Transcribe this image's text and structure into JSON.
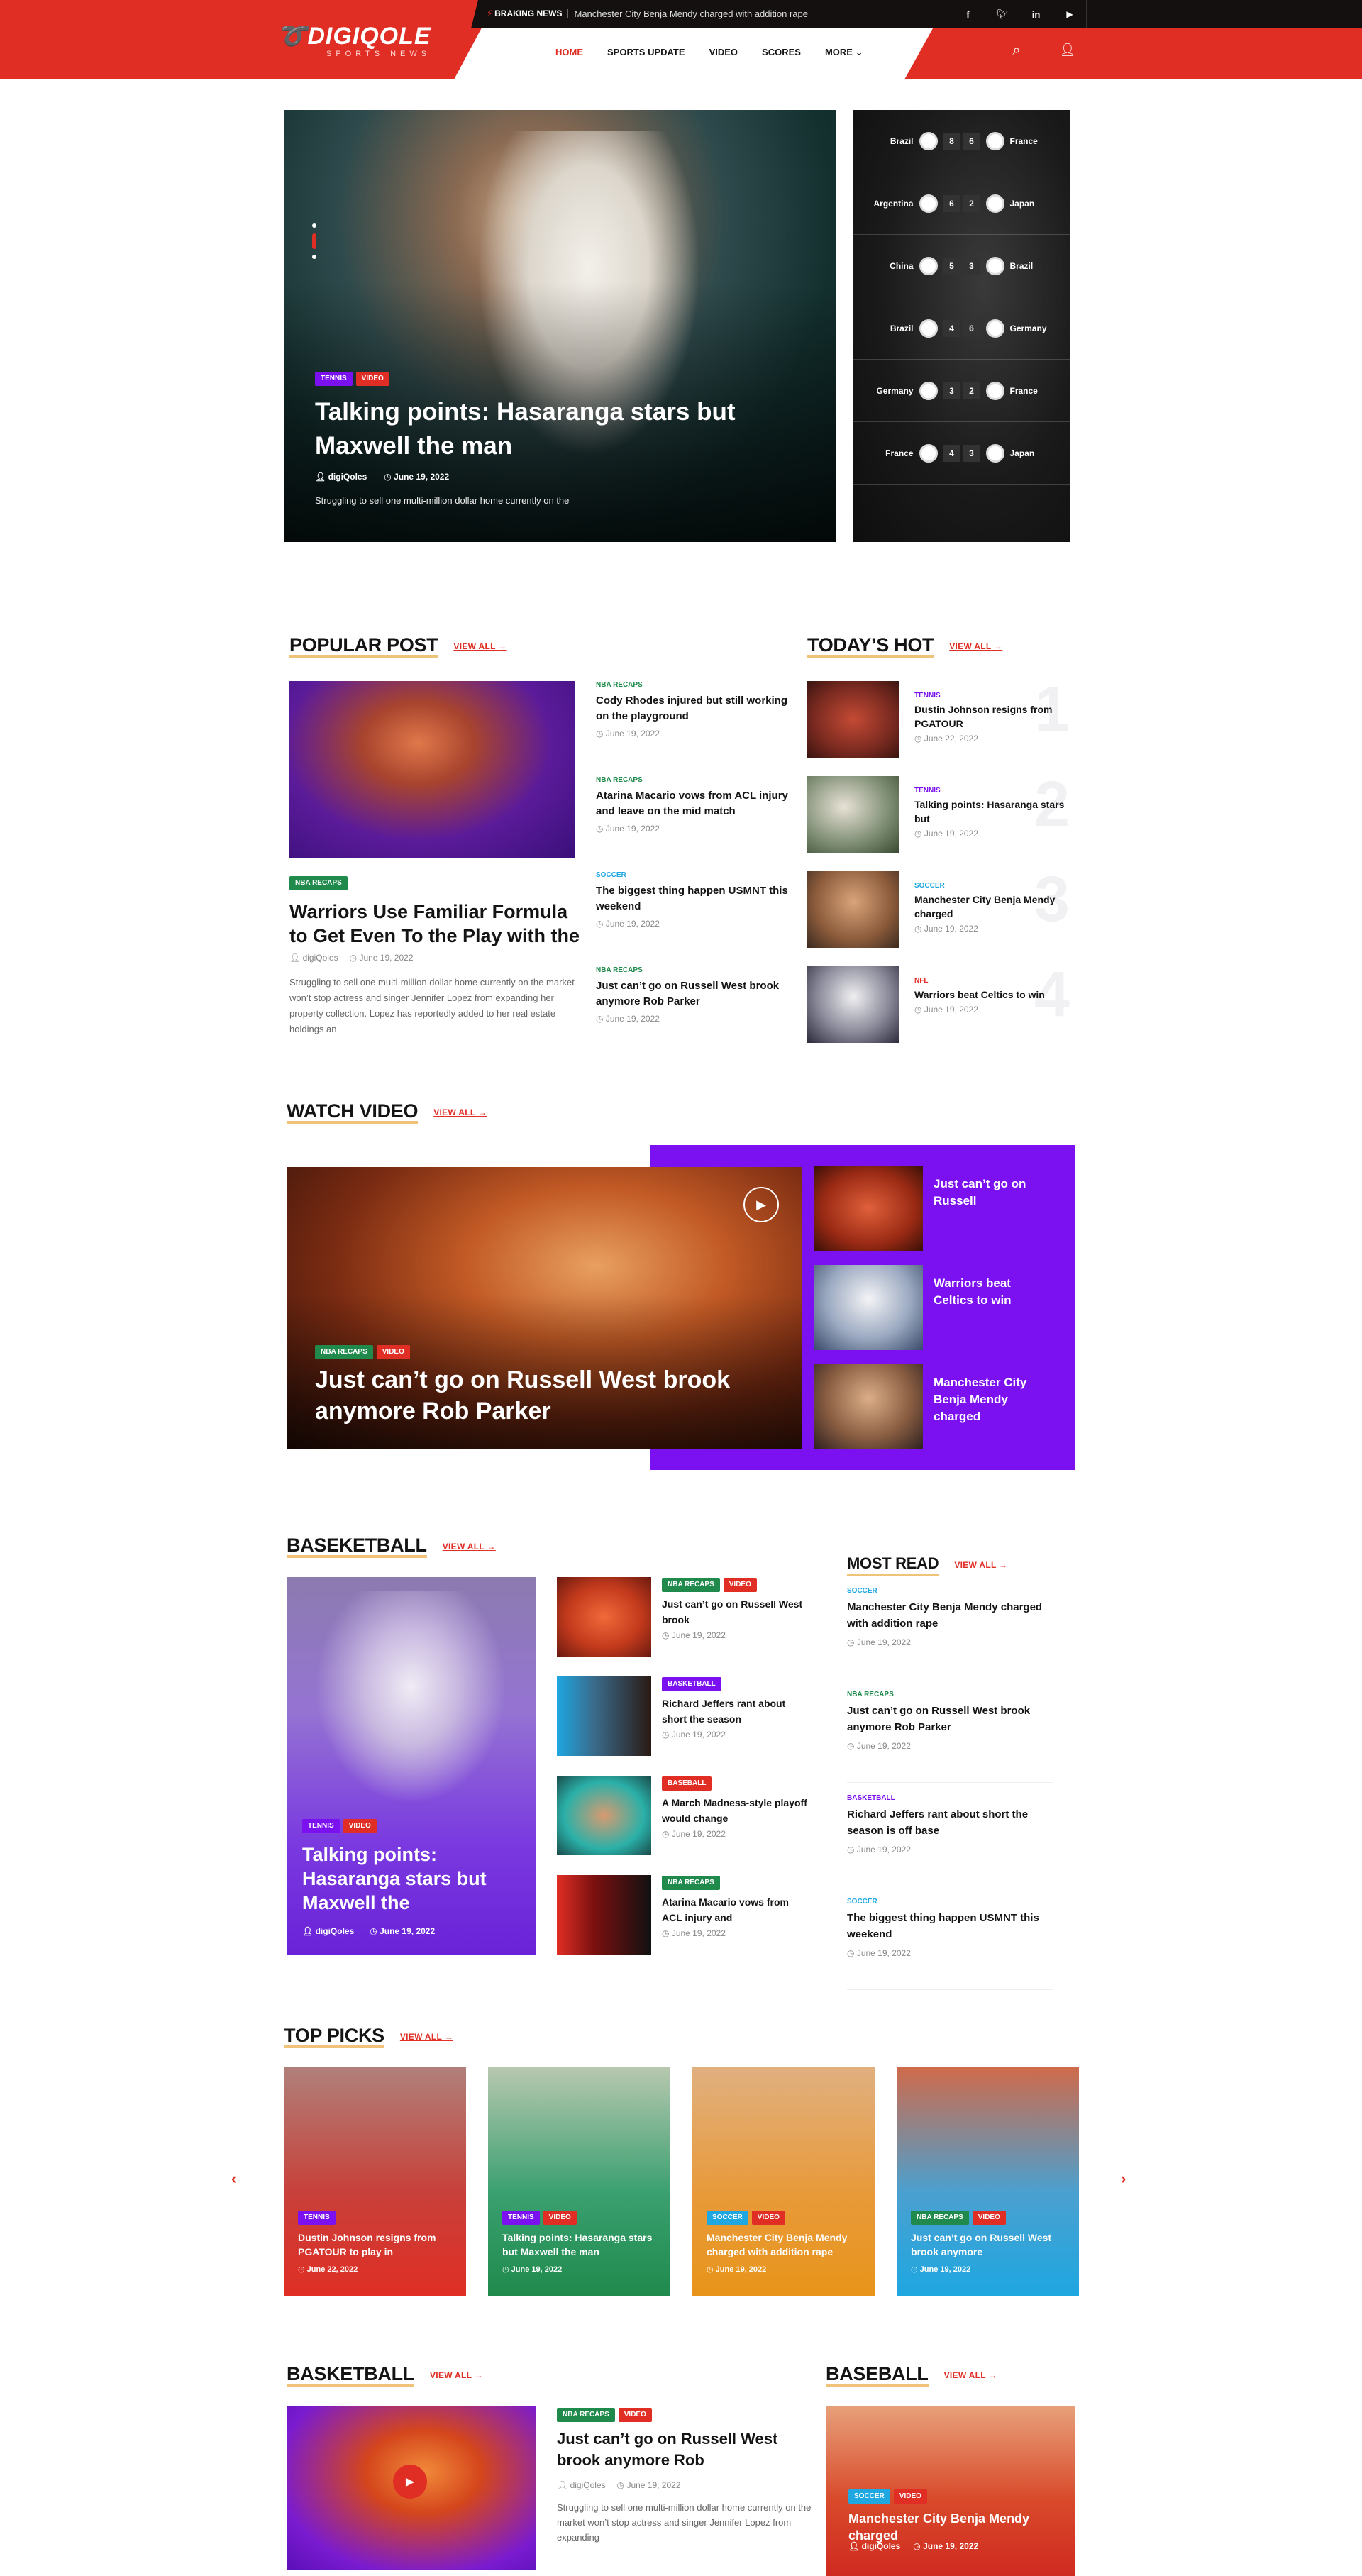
{
  "colors": {
    "primary": "#e02e24",
    "dark": "#141010",
    "purple": "#7b10f0",
    "green": "#1f8a4c",
    "orange": "#e8941a",
    "blue": "#1ea7e1"
  },
  "header": {
    "logo": "DIGIQOLE",
    "tagline": "SPORTS NEWS",
    "breaking_label": "BRAKING NEWS",
    "breaking_text": "Manchester City Benja Mendy charged with addition rape",
    "social": [
      "f",
      "t",
      "in",
      "yt"
    ],
    "nav": [
      "HOME",
      "SPORTS UPDATE",
      "VIDEO",
      "SCORES",
      "MORE"
    ]
  },
  "hero": {
    "tags": [
      "TENNIS",
      "VIDEO"
    ],
    "title": "Talking points: Hasaranga stars but Maxwell the man",
    "author": "digiQoles",
    "date": "June 19, 2022",
    "excerpt": "Struggling to sell one multi-million dollar home currently on the"
  },
  "scores": [
    {
      "home": "Brazil",
      "hs": "8",
      "as": "6",
      "away": "France"
    },
    {
      "home": "Argentina",
      "hs": "6",
      "as": "2",
      "away": "Japan"
    },
    {
      "home": "China",
      "hs": "5",
      "as": "3",
      "away": "Brazil"
    },
    {
      "home": "Brazil",
      "hs": "4",
      "as": "6",
      "away": "Germany"
    },
    {
      "home": "Germany",
      "hs": "3",
      "as": "2",
      "away": "France"
    },
    {
      "home": "France",
      "hs": "4",
      "as": "3",
      "away": "Japan"
    }
  ],
  "popular": {
    "title": "POPULAR POST",
    "viewall": "VIEW ALL",
    "main": {
      "tag": "NBA RECAPS",
      "title": "Warriors Use Familiar Formula to Get Even To the Play with the",
      "author": "digiQoles",
      "date": "June 19, 2022",
      "excerpt": "Struggling to sell one multi-million dollar home currently on the market won’t stop actress and singer Jennifer Lopez from expanding her property collection. Lopez has reportedly added to her real estate holdings an"
    },
    "list": [
      {
        "cat": "NBA RECAPS",
        "title": "Cody Rhodes injured but still working on the playground",
        "date": "June 19, 2022"
      },
      {
        "cat": "NBA RECAPS",
        "title": "Atarina Macario vows from ACL injury and leave on the mid match",
        "date": "June 19, 2022"
      },
      {
        "cat": "SOCCER",
        "title": "The biggest thing happen USMNT this weekend",
        "date": "June 19, 2022"
      },
      {
        "cat": "NBA RECAPS",
        "title": "Just can’t go on Russell West brook anymore Rob Parker",
        "date": "June 19, 2022"
      }
    ]
  },
  "hot": {
    "title": "TODAY’S HOT",
    "viewall": "VIEW ALL",
    "items": [
      {
        "cat": "TENNIS",
        "title": "Dustin Johnson resigns from PGATOUR",
        "date": "June 22, 2022",
        "num": "1"
      },
      {
        "cat": "TENNIS",
        "title": "Talking points: Hasaranga stars but",
        "date": "June 19, 2022",
        "num": "2"
      },
      {
        "cat": "SOCCER",
        "title": "Manchester City Benja Mendy charged",
        "date": "June 19, 2022",
        "num": "3"
      },
      {
        "cat": "NFL",
        "title": "Warriors beat Celtics to win",
        "date": "June 19, 2022",
        "num": "4"
      }
    ]
  },
  "video": {
    "title": "WATCH VIDEO",
    "viewall": "VIEW ALL",
    "main": {
      "tags": [
        "NBA RECAPS",
        "VIDEO"
      ],
      "title": "Just can’t go on Russell West brook anymore Rob Parker"
    },
    "side": [
      "Just can’t go on Russell",
      "Warriors beat Celtics to win",
      "Manchester City Benja Mendy charged"
    ]
  },
  "basketball": {
    "title": "BASEKETBALL",
    "viewall": "VIEW ALL",
    "main": {
      "tags": [
        "TENNIS",
        "VIDEO"
      ],
      "title": "Talking points: Hasaranga stars but Maxwell the",
      "author": "digiQoles",
      "date": "June 19, 2022"
    },
    "list": [
      {
        "tags": [
          "NBA RECAPS",
          "VIDEO"
        ],
        "title": "Just can’t go on Russell West brook",
        "date": "June 19, 2022"
      },
      {
        "tags": [
          "BASKETBALL"
        ],
        "title": "Richard Jeffers rant about short the season",
        "date": "June 19, 2022"
      },
      {
        "tags": [
          "BASEBALL"
        ],
        "title": "A March Madness-style playoff would change",
        "date": "June 19, 2022"
      },
      {
        "tags": [
          "NBA RECAPS"
        ],
        "title": "Atarina Macario vows from ACL injury and",
        "date": "June 19, 2022"
      }
    ]
  },
  "mostread": {
    "title": "MOST READ",
    "viewall": "VIEW ALL",
    "items": [
      {
        "cat": "SOCCER",
        "title": "Manchester City Benja Mendy charged with addition rape",
        "date": "June 19, 2022"
      },
      {
        "cat": "NBA RECAPS",
        "title": "Just can’t go on Russell West brook anymore Rob Parker",
        "date": "June 19, 2022"
      },
      {
        "cat": "BASKETBALL",
        "title": "Richard Jeffers rant about short the season is off base",
        "date": "June 19, 2022"
      },
      {
        "cat": "SOCCER",
        "title": "The biggest thing happen USMNT this weekend",
        "date": "June 19, 2022"
      }
    ]
  },
  "toppicks": {
    "title": "TOP PICKS",
    "viewall": "VIEW ALL",
    "cards": [
      {
        "tags": [
          "TENNIS"
        ],
        "title": "Dustin Johnson resigns from PGATOUR to play in",
        "date": "June 22, 2022"
      },
      {
        "tags": [
          "TENNIS",
          "VIDEO"
        ],
        "title": "Talking points: Hasaranga stars but Maxwell the man",
        "date": "June 19, 2022"
      },
      {
        "tags": [
          "SOCCER",
          "VIDEO"
        ],
        "title": "Manchester City Benja Mendy charged with addition rape",
        "date": "June 19, 2022"
      },
      {
        "tags": [
          "NBA RECAPS",
          "VIDEO"
        ],
        "title": "Just can’t go on Russell West brook anymore",
        "date": "June 19, 2022"
      }
    ]
  },
  "basketball2": {
    "title": "BASKETBALL",
    "viewall": "VIEW ALL",
    "tags": [
      "NBA RECAPS",
      "VIDEO"
    ],
    "headline": "Just can’t go on Russell West brook anymore Rob",
    "author": "digiQoles",
    "date": "June 19, 2022",
    "excerpt": "Struggling to sell one multi-million dollar home currently on the market won’t stop actress and singer Jennifer Lopez from expanding"
  },
  "baseball": {
    "title": "BASEBALL",
    "viewall": "VIEW ALL",
    "tags": [
      "SOCCER",
      "VIDEO"
    ],
    "headline": "Manchester City Benja Mendy charged",
    "author": "digiQoles",
    "date": "June 19, 2022"
  }
}
